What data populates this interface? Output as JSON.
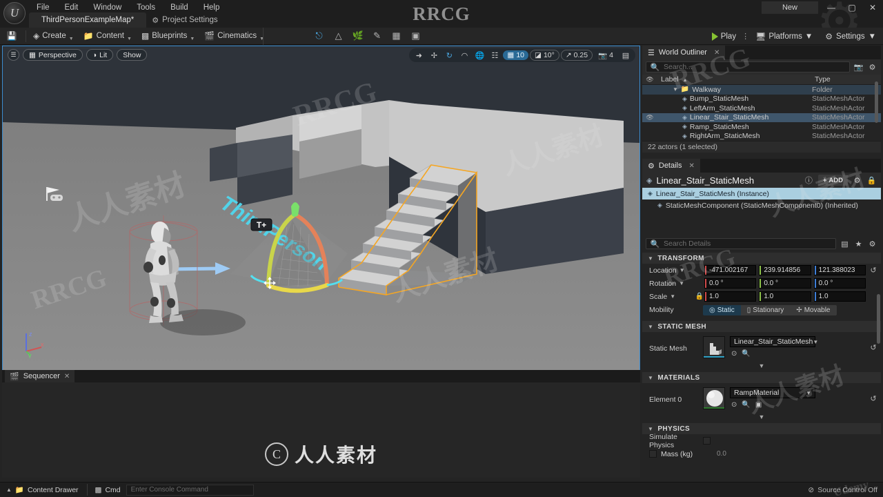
{
  "window": {
    "title_watermark": "RRCG",
    "new_button": "New",
    "minimize": "—",
    "maximize": "▢",
    "close": "✕"
  },
  "menu": {
    "items": [
      "File",
      "Edit",
      "Window",
      "Tools",
      "Build",
      "Help"
    ]
  },
  "tabs": {
    "level_tab": "ThirdPersonExampleMap*",
    "project_settings_tab": "Project Settings"
  },
  "toolbar": {
    "save_icon": "save-icon",
    "items": [
      {
        "label": "Create",
        "icon": "create-cube-icon"
      },
      {
        "label": "Content",
        "icon": "content-folder-icon"
      },
      {
        "label": "Blueprints",
        "icon": "blueprint-icon"
      },
      {
        "label": "Cinematics",
        "icon": "clapperboard-icon"
      }
    ],
    "mode_icons": [
      "select-mode-icon",
      "landscape-mode-icon",
      "foliage-mode-icon",
      "mesh-paint-icon",
      "fracture-icon",
      "brush-edit-icon"
    ],
    "play_label": "Play",
    "platforms_label": "Platforms",
    "settings_label": "Settings"
  },
  "viewport": {
    "menu_icon": "hamburger-icon",
    "perspective_label": "Perspective",
    "lit_label": "Lit",
    "show_label": "Show",
    "transform_tools": [
      "select-tool-icon",
      "translate-tool-icon",
      "rotate-tool-icon",
      "scale-tool-icon"
    ],
    "coord_icon": "world-coords-icon",
    "surface_snap_icon": "surface-snap-icon",
    "grid_snap_value": "10",
    "angle_snap_value": "10°",
    "scale_snap_value": "0.25",
    "camera_speed_value": "4",
    "layout_icon": "viewport-layout-icon",
    "floor_decal_text": "ThirdPerson",
    "gizmo_axes": [
      "z",
      "x",
      "y"
    ]
  },
  "sequencer": {
    "tab_label": "Sequencer",
    "close": "✕"
  },
  "outliner": {
    "tab_label": "World Outliner",
    "close": "✕",
    "search_placeholder": "Search...",
    "columns": {
      "visibility": "👁",
      "label": "Label",
      "sort_arrow": "▲",
      "type": "Type"
    },
    "rows": [
      {
        "name": "Walkway",
        "type": "Folder",
        "kind": "folder",
        "indent": 1,
        "eye": false,
        "selected": false
      },
      {
        "name": "Bump_StaticMesh",
        "type": "StaticMeshActor",
        "kind": "mesh",
        "indent": 2,
        "eye": false,
        "selected": false
      },
      {
        "name": "LeftArm_StaticMesh",
        "type": "StaticMeshActor",
        "kind": "mesh",
        "indent": 2,
        "eye": false,
        "selected": false
      },
      {
        "name": "Linear_Stair_StaticMesh",
        "type": "StaticMeshActor",
        "kind": "mesh",
        "indent": 2,
        "eye": true,
        "selected": true
      },
      {
        "name": "Ramp_StaticMesh",
        "type": "StaticMeshActor",
        "kind": "mesh",
        "indent": 2,
        "eye": false,
        "selected": false
      },
      {
        "name": "RightArm_StaticMesh",
        "type": "StaticMeshActor",
        "kind": "mesh",
        "indent": 2,
        "eye": false,
        "selected": false
      }
    ],
    "status": "22 actors (1 selected)"
  },
  "details": {
    "tab_label": "Details",
    "close": "✕",
    "actor_name": "Linear_Stair_StaticMesh",
    "help_icon": "help-circle-icon",
    "add_label": "ADD",
    "add_plus": "+",
    "blueprint_icon": "blueprint-split-icon",
    "lock_icon": "lock-icon",
    "components": [
      {
        "label": "Linear_Stair_StaticMesh (Instance)",
        "selected": true
      },
      {
        "label": "StaticMeshComponent (StaticMeshComponent0) (Inherited)",
        "selected": false
      }
    ],
    "search_placeholder": "Search Details",
    "search_icons": [
      "columns-icon",
      "favorite-star-icon",
      "settings-gear-icon"
    ],
    "sections": {
      "transform": {
        "title": "TRANSFORM",
        "location": {
          "label": "Location",
          "x": "-471.002167",
          "y": "239.914856",
          "z": "121.388023"
        },
        "rotation": {
          "label": "Rotation",
          "x": "0.0 °",
          "y": "0.0 °",
          "z": "0.0 °"
        },
        "scale": {
          "label": "Scale",
          "x": "1.0",
          "y": "1.0",
          "z": "1.0"
        },
        "mobility": {
          "label": "Mobility",
          "options": [
            "Static",
            "Stationary",
            "Movable"
          ],
          "selected": "Static"
        }
      },
      "static_mesh": {
        "title": "STATIC MESH",
        "property_label": "Static Mesh",
        "asset_name": "Linear_Stair_StaticMesh",
        "underline_color": "#2ea0c4"
      },
      "materials": {
        "title": "MATERIALS",
        "property_label": "Element 0",
        "asset_name": "RampMaterial",
        "underline_color": "#2e7a2e"
      },
      "physics": {
        "title": "PHYSICS",
        "simulate_physics_label": "Simulate Physics",
        "mass_label": "Mass (kg)",
        "mass_value": "0.0"
      }
    }
  },
  "statusbar": {
    "content_drawer": "Content Drawer",
    "cmd_label": "Cmd",
    "console_placeholder": "Enter Console Command",
    "source_control": "Source Control Off",
    "source_control_icon": "no-entry-icon"
  },
  "watermarks": {
    "rrcg": "RRCG",
    "cn_text": "人人素材",
    "udemy": "Udemy",
    "center_logo_letter": "C"
  }
}
